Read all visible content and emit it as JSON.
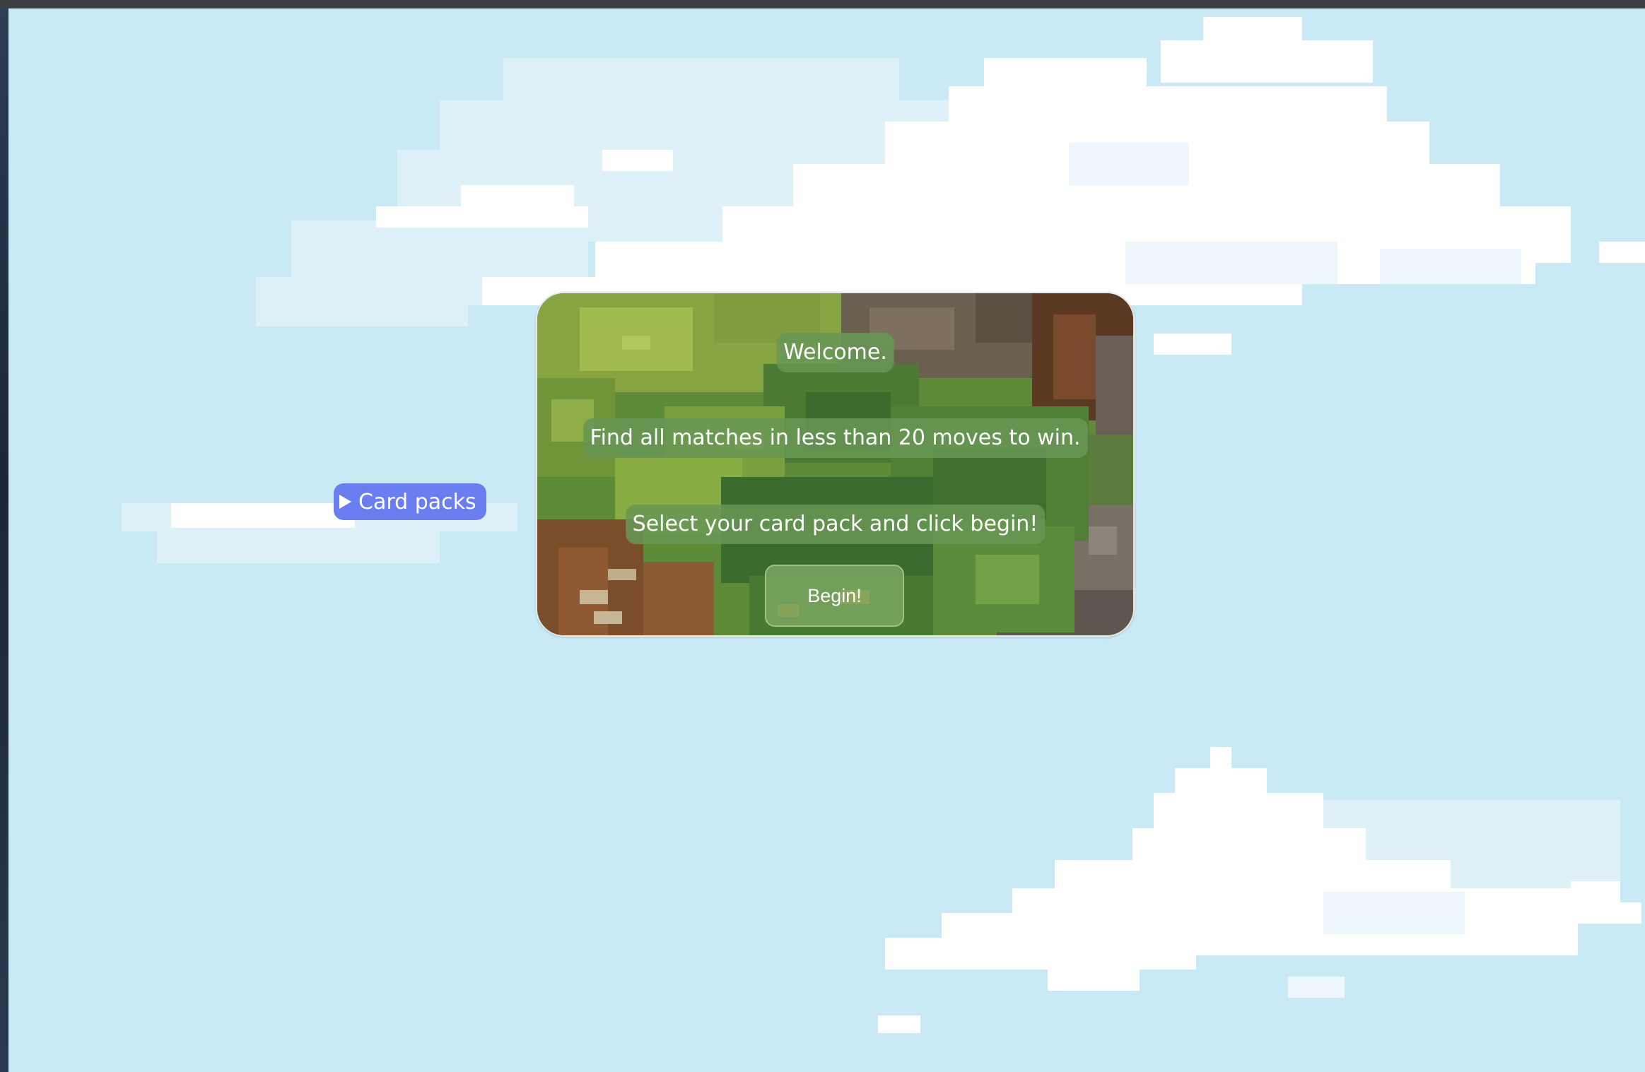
{
  "colors": {
    "sky": "#c9e9f5",
    "cloud": "#ffffff",
    "cloud_shade": "#e2f3fa",
    "panel_text_bg": "#689654",
    "card_packs_bg": "#6a7ef0"
  },
  "card_packs": {
    "label": "Card packs",
    "icon": "triangle-right-icon"
  },
  "modal": {
    "welcome": "Welcome.",
    "rules": "Find all matches in less than 20 moves to win.",
    "instruction": "Select your card pack and click begin!",
    "begin_label": "Begin!"
  }
}
